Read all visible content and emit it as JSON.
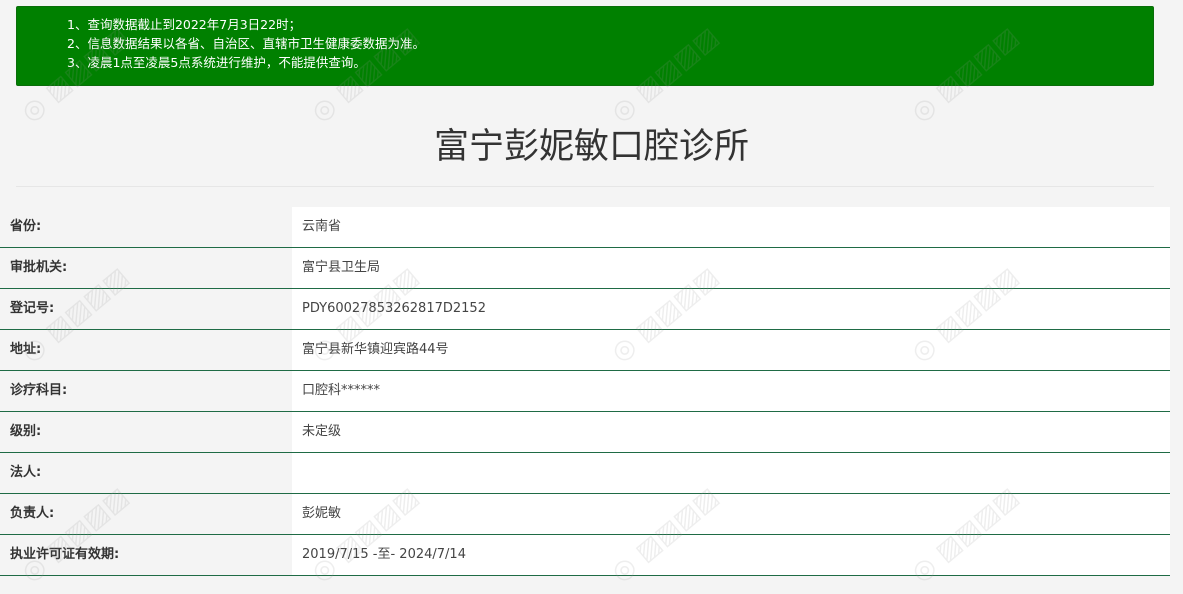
{
  "notice": {
    "items": [
      "1、查询数据截止到2022年7月3日22时；",
      "2、信息数据结果以各省、自治区、直辖市卫生健康委数据为准。",
      "3、凌晨1点至凌晨5点系统进行维护，不能提供查询。"
    ]
  },
  "page_title": "富宁彭妮敏口腔诊所",
  "info": {
    "rows": [
      {
        "label": "省份:",
        "value": "云南省"
      },
      {
        "label": "审批机关:",
        "value": "富宁县卫生局"
      },
      {
        "label": "登记号:",
        "value": "PDY60027853262817D2152"
      },
      {
        "label": "地址:",
        "value": "富宁县新华镇迎宾路44号"
      },
      {
        "label": "诊疗科目:",
        "value": "口腔科******"
      },
      {
        "label": "级别:",
        "value": "未定级"
      },
      {
        "label": "法人:",
        "value": ""
      },
      {
        "label": "负责人:",
        "value": "彭妮敏"
      },
      {
        "label": "执业许可证有效期:",
        "value": "2019/7/15 -至- 2024/7/14"
      }
    ]
  },
  "colors": {
    "notice_bg": "#008000",
    "row_border": "#1f6b45",
    "page_bg": "#f4f4f4"
  }
}
